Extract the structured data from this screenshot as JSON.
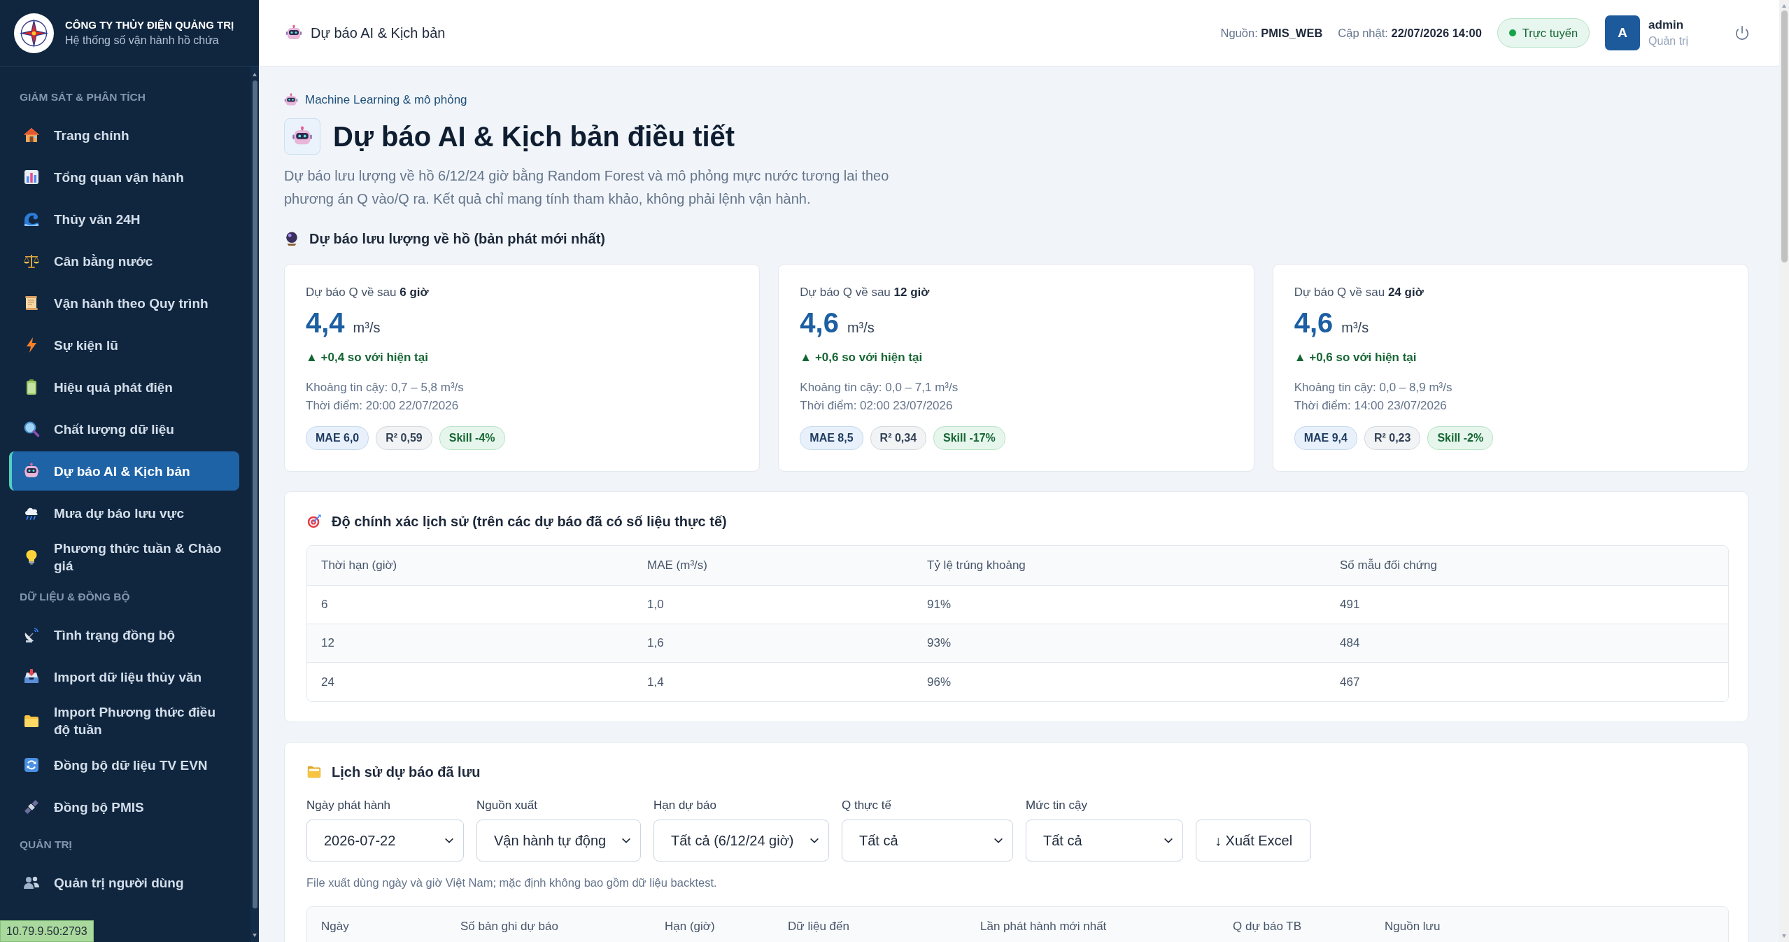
{
  "sidebar": {
    "brand": {
      "name": "CÔNG TY THỦY ĐIỆN QUẢNG TRỊ",
      "subtitle": "Hệ thống số vận hành hồ chứa"
    },
    "groups": [
      {
        "title": "GIÁM SÁT & PHÂN TÍCH",
        "items": [
          {
            "label": "Trang chính",
            "selected": false
          },
          {
            "label": "Tổng quan vận hành",
            "selected": false
          },
          {
            "label": "Thủy văn 24H",
            "selected": false
          },
          {
            "label": "Cân bằng nước",
            "selected": false
          },
          {
            "label": "Vận hành theo Quy trình",
            "selected": false
          },
          {
            "label": "Sự kiện lũ",
            "selected": false
          },
          {
            "label": "Hiệu quả phát điện",
            "selected": false
          },
          {
            "label": "Chất lượng dữ liệu",
            "selected": false
          },
          {
            "label": "Dự báo AI & Kịch bản",
            "selected": true
          },
          {
            "label": "Mưa dự báo lưu vực",
            "selected": false
          },
          {
            "label": "Phương thức tuần & Chào giá",
            "selected": false
          }
        ]
      },
      {
        "title": "DỮ LIỆU & ĐỒNG BỘ",
        "items": [
          {
            "label": "Tình trạng đồng bộ",
            "selected": false
          },
          {
            "label": "Import dữ liệu thủy văn",
            "selected": false
          },
          {
            "label": "Import Phương thức điều độ tuần",
            "selected": false
          },
          {
            "label": "Đồng bộ dữ liệu TV EVN",
            "selected": false
          },
          {
            "label": "Đồng bộ PMIS",
            "selected": false
          }
        ]
      },
      {
        "title": "QUẢN TRỊ",
        "items": [
          {
            "label": "Quản trị người dùng",
            "selected": false
          }
        ]
      }
    ]
  },
  "header": {
    "title": "Dự báo AI & Kịch bản",
    "source": "Nguồn: **PMIS_WEB**",
    "updated": "Cập nhật: **22/07/2026 14:00**",
    "status": {
      "label": "Trực tuyến",
      "online": true
    },
    "user": {
      "initial": "A",
      "name": "admin",
      "role": "Quản trị"
    }
  },
  "page": {
    "eyebrow": "Machine Learning & mô phỏng",
    "title": "Dự báo AI & Kịch bản điều tiết",
    "description": "Dự báo lưu lượng về hồ 6/12/24 giờ bằng Random Forest và mô phỏng mực nước tương lai theo phương án Q vào/Q ra. Kết quả chỉ mang tính tham khảo, không phải lệnh vận hành."
  },
  "forecast": {
    "title": "Dự báo lưu lượng về hồ (bản phát mới nhất)",
    "cards": [
      {
        "label": "Dự báo Q về sau **6 giờ**",
        "value": "4,4",
        "unit": "m³/s",
        "delta": "▲ +0,4 so với hiện tại",
        "interval": "Khoảng tin cậy: 0,7 – 5,8 m³/s",
        "time": "Thời điểm: 20:00 22/07/2026",
        "badges": [
          {
            "kind": "mae",
            "text": "MAE 6,0"
          },
          {
            "kind": "r2",
            "text": "R² 0,59"
          },
          {
            "kind": "skill",
            "text": "Skill -4%"
          }
        ]
      },
      {
        "label": "Dự báo Q về sau **12 giờ**",
        "value": "4,6",
        "unit": "m³/s",
        "delta": "▲ +0,6 so với hiện tại",
        "interval": "Khoảng tin cậy: 0,0 – 7,1 m³/s",
        "time": "Thời điểm: 02:00 23/07/2026",
        "badges": [
          {
            "kind": "mae",
            "text": "MAE 8,5"
          },
          {
            "kind": "r2",
            "text": "R² 0,34"
          },
          {
            "kind": "skill",
            "text": "Skill -17%"
          }
        ]
      },
      {
        "label": "Dự báo Q về sau **24 giờ**",
        "value": "4,6",
        "unit": "m³/s",
        "delta": "▲ +0,6 so với hiện tại",
        "interval": "Khoảng tin cậy: 0,0 – 8,9 m³/s",
        "time": "Thời điểm: 14:00 23/07/2026",
        "badges": [
          {
            "kind": "mae",
            "text": "MAE 9,4"
          },
          {
            "kind": "r2",
            "text": "R² 0,23"
          },
          {
            "kind": "skill",
            "text": "Skill -2%"
          }
        ]
      }
    ]
  },
  "accuracy": {
    "title": "Độ chính xác lịch sử (trên các dự báo đã có số liệu thực tế)",
    "columns": [
      "Thời hạn (giờ)",
      "MAE (m³/s)",
      "Tỷ lệ trúng khoảng",
      "Số mẫu đối chứng"
    ],
    "rows": [
      [
        "6",
        "1,0",
        "91%",
        "491"
      ],
      [
        "12",
        "1,6",
        "93%",
        "484"
      ],
      [
        "24",
        "1,4",
        "96%",
        "467"
      ]
    ]
  },
  "history": {
    "title": "Lịch sử dự báo đã lưu",
    "filters": [
      {
        "label": "Ngày phát hành",
        "value": "2026-07-22"
      },
      {
        "label": "Nguồn xuất",
        "value": "Vận hành tự động"
      },
      {
        "label": "Hạn dự báo",
        "value": "Tất cả (6/12/24 giờ)"
      },
      {
        "label": "Q thực tế",
        "value": "Tất cả"
      },
      {
        "label": "Mức tin cậy",
        "value": "Tất cả"
      }
    ],
    "export_button": "↓ Xuất Excel",
    "note": "File xuất dùng ngày và giờ Việt Nam; mặc định không bao gồm dữ liệu backtest.",
    "columns": [
      "Ngày",
      "Số bản ghi dự báo",
      "Hạn (giờ)",
      "Dữ liệu đến",
      "Lần phát hành mới nhất",
      "Q dự báo TB",
      "Nguồn lưu"
    ]
  },
  "browser_status": "10.79.9.50:2793"
}
